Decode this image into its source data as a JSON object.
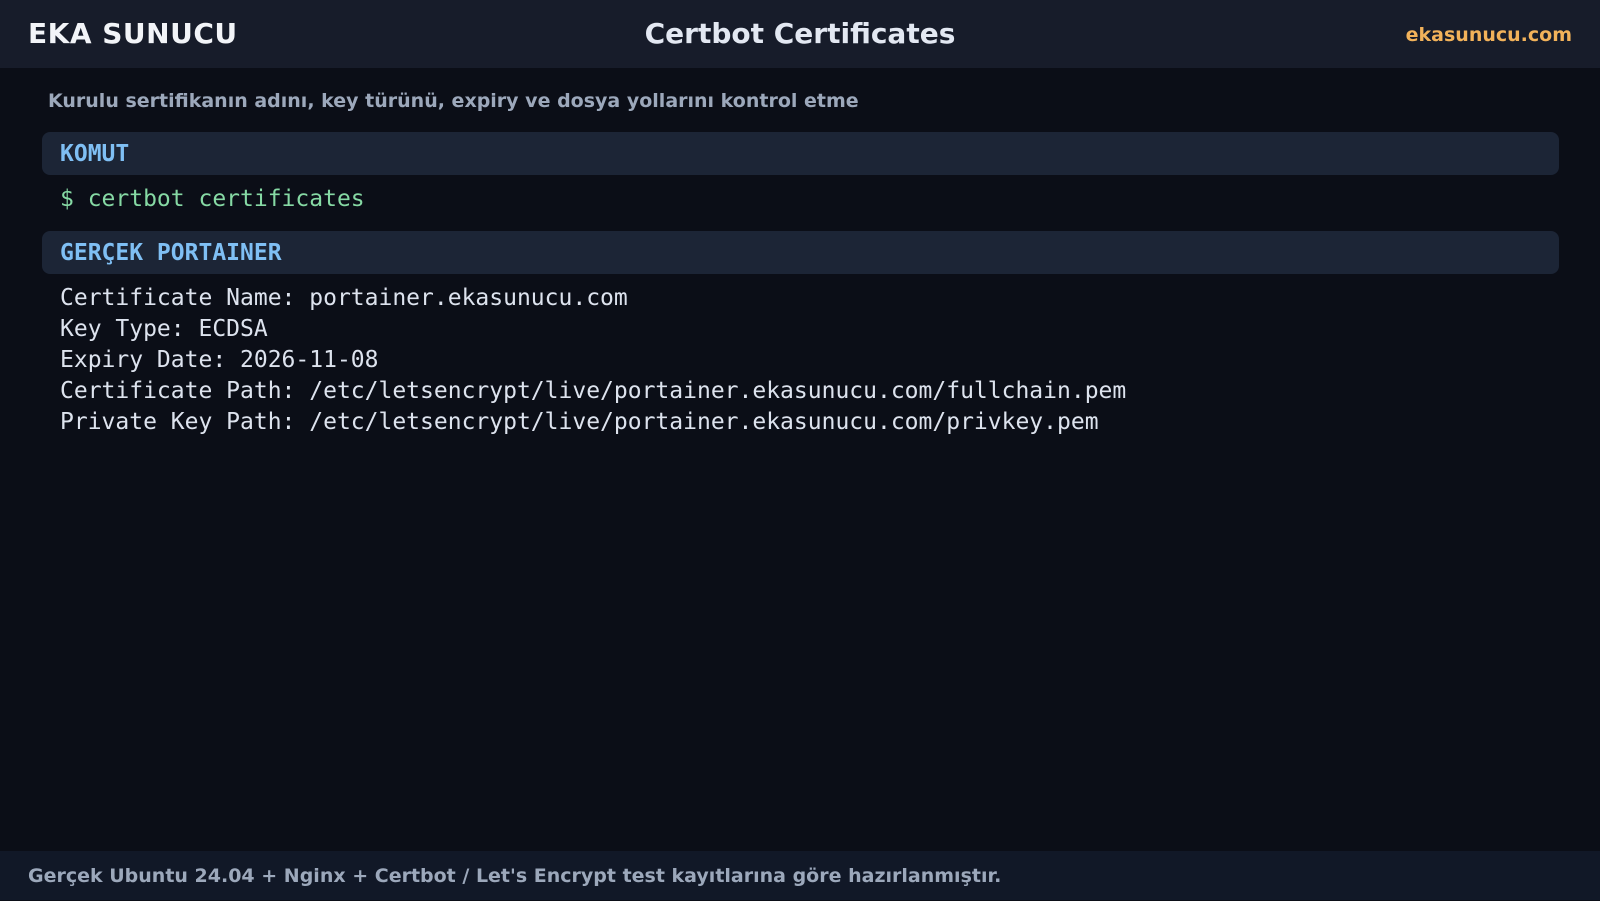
{
  "header": {
    "brand": "EKA SUNUCU",
    "title": "Certbot Certificates",
    "site": "ekasunucu.com"
  },
  "subtitle": "Kurulu sertifikanın adını, key türünü, expiry ve dosya yollarını kontrol etme",
  "sections": {
    "command": {
      "label": "KOMUT",
      "text": "$ certbot certificates"
    },
    "output": {
      "label": "GERÇEK PORTAINER",
      "lines": [
        "Certificate Name: portainer.ekasunucu.com",
        "Key Type: ECDSA",
        "Expiry Date: 2026-11-08",
        "Certificate Path: /etc/letsencrypt/live/portainer.ekasunucu.com/fullchain.pem",
        "Private Key Path: /etc/letsencrypt/live/portainer.ekasunucu.com/privkey.pem"
      ]
    }
  },
  "footer": {
    "note": "Gerçek Ubuntu 24.04 + Nginx + Certbot / Let's Encrypt test kayıtlarına göre hazırlanmıştır."
  },
  "colors": {
    "background": "#0b0e17",
    "topbar": "#171c2a",
    "section_header_bg": "#1c2536",
    "section_label": "#7fbff4",
    "command_text": "#86d9a4",
    "accent_link": "#f2b25a"
  }
}
